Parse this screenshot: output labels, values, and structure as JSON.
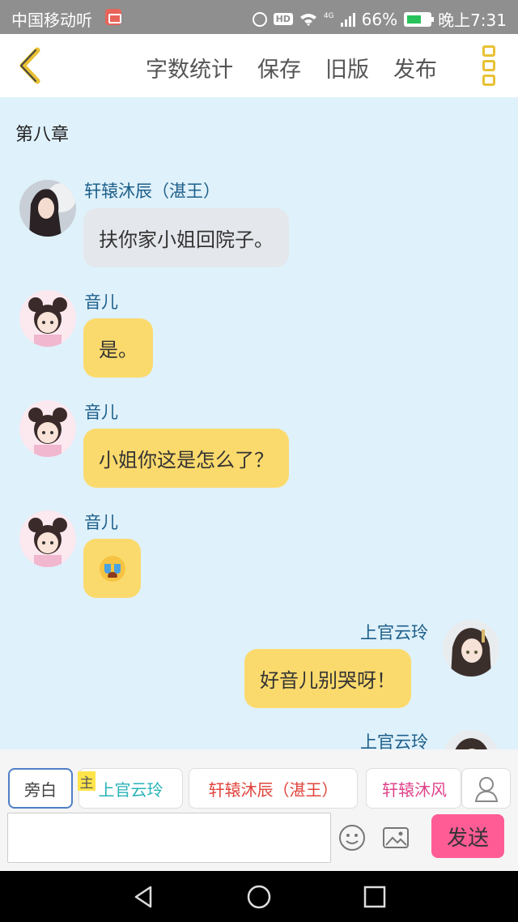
{
  "status_bar": {
    "carrier": "中国移动听",
    "network": "4G",
    "battery": "66%",
    "battery_level": 0.66,
    "time": "晚上7:31",
    "hd_badge": "HD"
  },
  "header": {
    "actions": [
      "字数统计",
      "保存",
      "旧版",
      "发布"
    ]
  },
  "chapter_title": "第八章",
  "messages": [
    {
      "speaker": "轩辕沐辰（湛王）",
      "text": "扶你家小姐回院子。",
      "side": "left",
      "bubble": "gray"
    },
    {
      "speaker": "音儿",
      "text": "是。",
      "side": "left",
      "bubble": "yellow"
    },
    {
      "speaker": "音儿",
      "text": "小姐你这是怎么了？",
      "side": "left",
      "bubble": "yellow"
    },
    {
      "speaker": "音儿",
      "text": "",
      "emoji": "crying-emoji",
      "side": "left",
      "bubble": "yellow"
    },
    {
      "speaker": "上官云玲",
      "text": "好音儿别哭呀！",
      "side": "right",
      "bubble": "yellow"
    },
    {
      "speaker": "上官云玲",
      "text": "",
      "side": "right"
    }
  ],
  "role_bar": {
    "chips": [
      "旁白",
      "上官云玲",
      "轩辕沐辰（湛王）",
      "轩辕沐风"
    ],
    "main_tag": "主",
    "selected": "旁白"
  },
  "composer": {
    "input_value": "",
    "send_label": "发送"
  },
  "colors": {
    "chat_bg": "#dff1fb",
    "bubble_yellow": "#fbda6d",
    "bubble_gray": "#e4e7ec",
    "send": "#ff5c96",
    "accent_gold": "#e8c133",
    "name_blue": "#1d5f8a"
  }
}
